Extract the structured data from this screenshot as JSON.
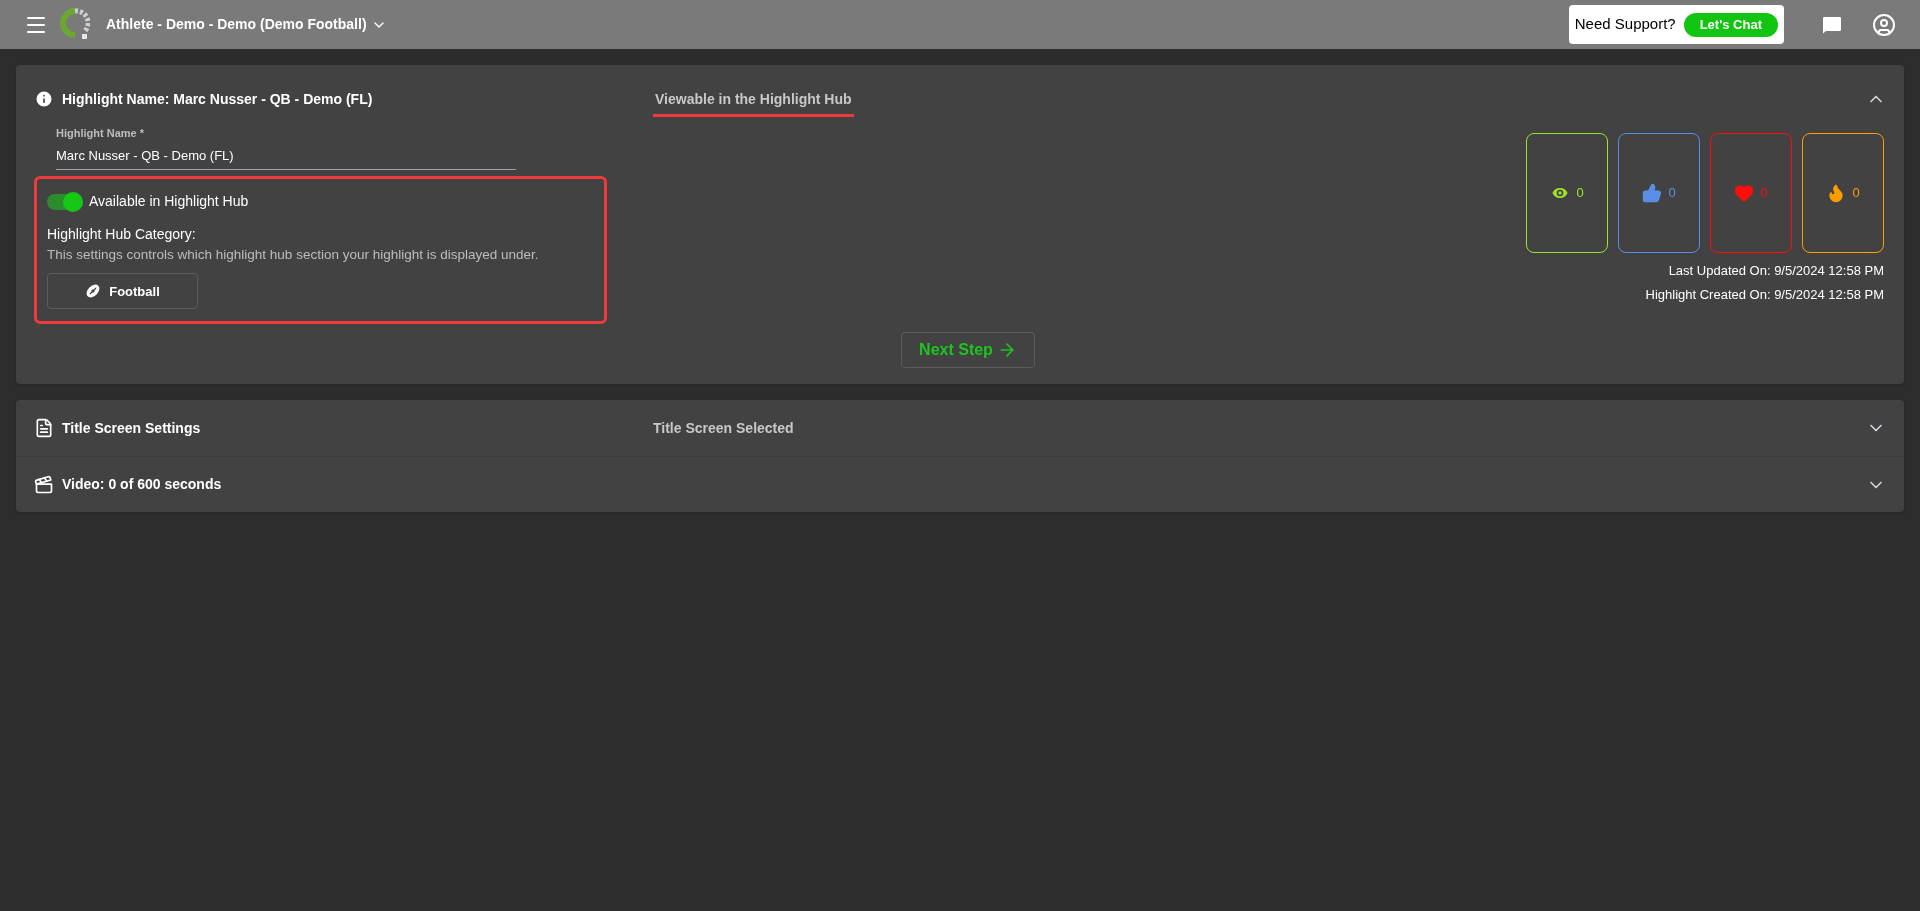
{
  "topbar": {
    "account": "Athlete - Demo - Demo (Demo Football)",
    "support_label": "Need Support?",
    "chat_button": "Let's Chat"
  },
  "highlight_panel": {
    "expanded": true,
    "title": "Highlight Name: Marc Nusser - QB - Demo (FL)",
    "status": "Viewable in the Highlight Hub",
    "name_field": {
      "label": "Highlight Name *",
      "value": "Marc Nusser - QB - Demo (FL)"
    },
    "hub_toggle": {
      "label": "Available in Highlight Hub",
      "on": true
    },
    "category_title": "Highlight Hub Category:",
    "category_help": "This settings controls which highlight hub section your highlight is displayed under.",
    "category_button": "Football",
    "stats": [
      {
        "kind": "views",
        "count": "0",
        "color": "#9fe22b"
      },
      {
        "kind": "likes",
        "count": "0",
        "color": "#5b8ee6"
      },
      {
        "kind": "loves",
        "count": "0",
        "color": "#ff0d0d"
      },
      {
        "kind": "fire",
        "count": "0",
        "color": "#ff9d00"
      }
    ],
    "last_updated": "Last Updated On: 9/5/2024 12:58 PM",
    "created": "Highlight Created On: 9/5/2024 12:58 PM",
    "next_button": "Next Step"
  },
  "sections": [
    {
      "kind": "title",
      "title": "Title Screen Settings",
      "status": "Title Screen Selected",
      "expanded": false
    },
    {
      "kind": "video",
      "title": "Video: 0 of 600 seconds",
      "expanded": false
    }
  ]
}
